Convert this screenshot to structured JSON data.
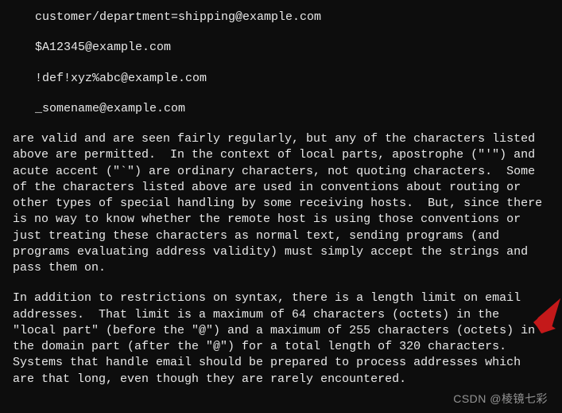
{
  "examples": [
    "customer/department=shipping@example.com",
    "$A12345@example.com",
    "!def!xyz%abc@example.com",
    "_somename@example.com"
  ],
  "paragraphs": [
    "are valid and are seen fairly regularly, but any of the characters listed above are permitted.  In the context of local parts, apostrophe (\"'\") and acute accent (\"`\") are ordinary characters, not quoting characters.  Some of the characters listed above are used in conventions about routing or other types of special handling by some receiving hosts.  But, since there is no way to know whether the remote host is using those conventions or just treating these characters as normal text, sending programs (and programs evaluating address validity) must simply accept the strings and pass them on.",
    "In addition to restrictions on syntax, there is a length limit on email addresses.  That limit is a maximum of 64 characters (octets) in the \"local part\" (before the \"@\") and a maximum of 255 characters (octets) in the domain part (after the \"@\") for a total length of 320 characters.  Systems that handle email should be prepared to process addresses which are that long, even though they are rarely encountered."
  ],
  "watermark": "CSDN @棱镜七彩",
  "arrow_color": "#c4191a"
}
